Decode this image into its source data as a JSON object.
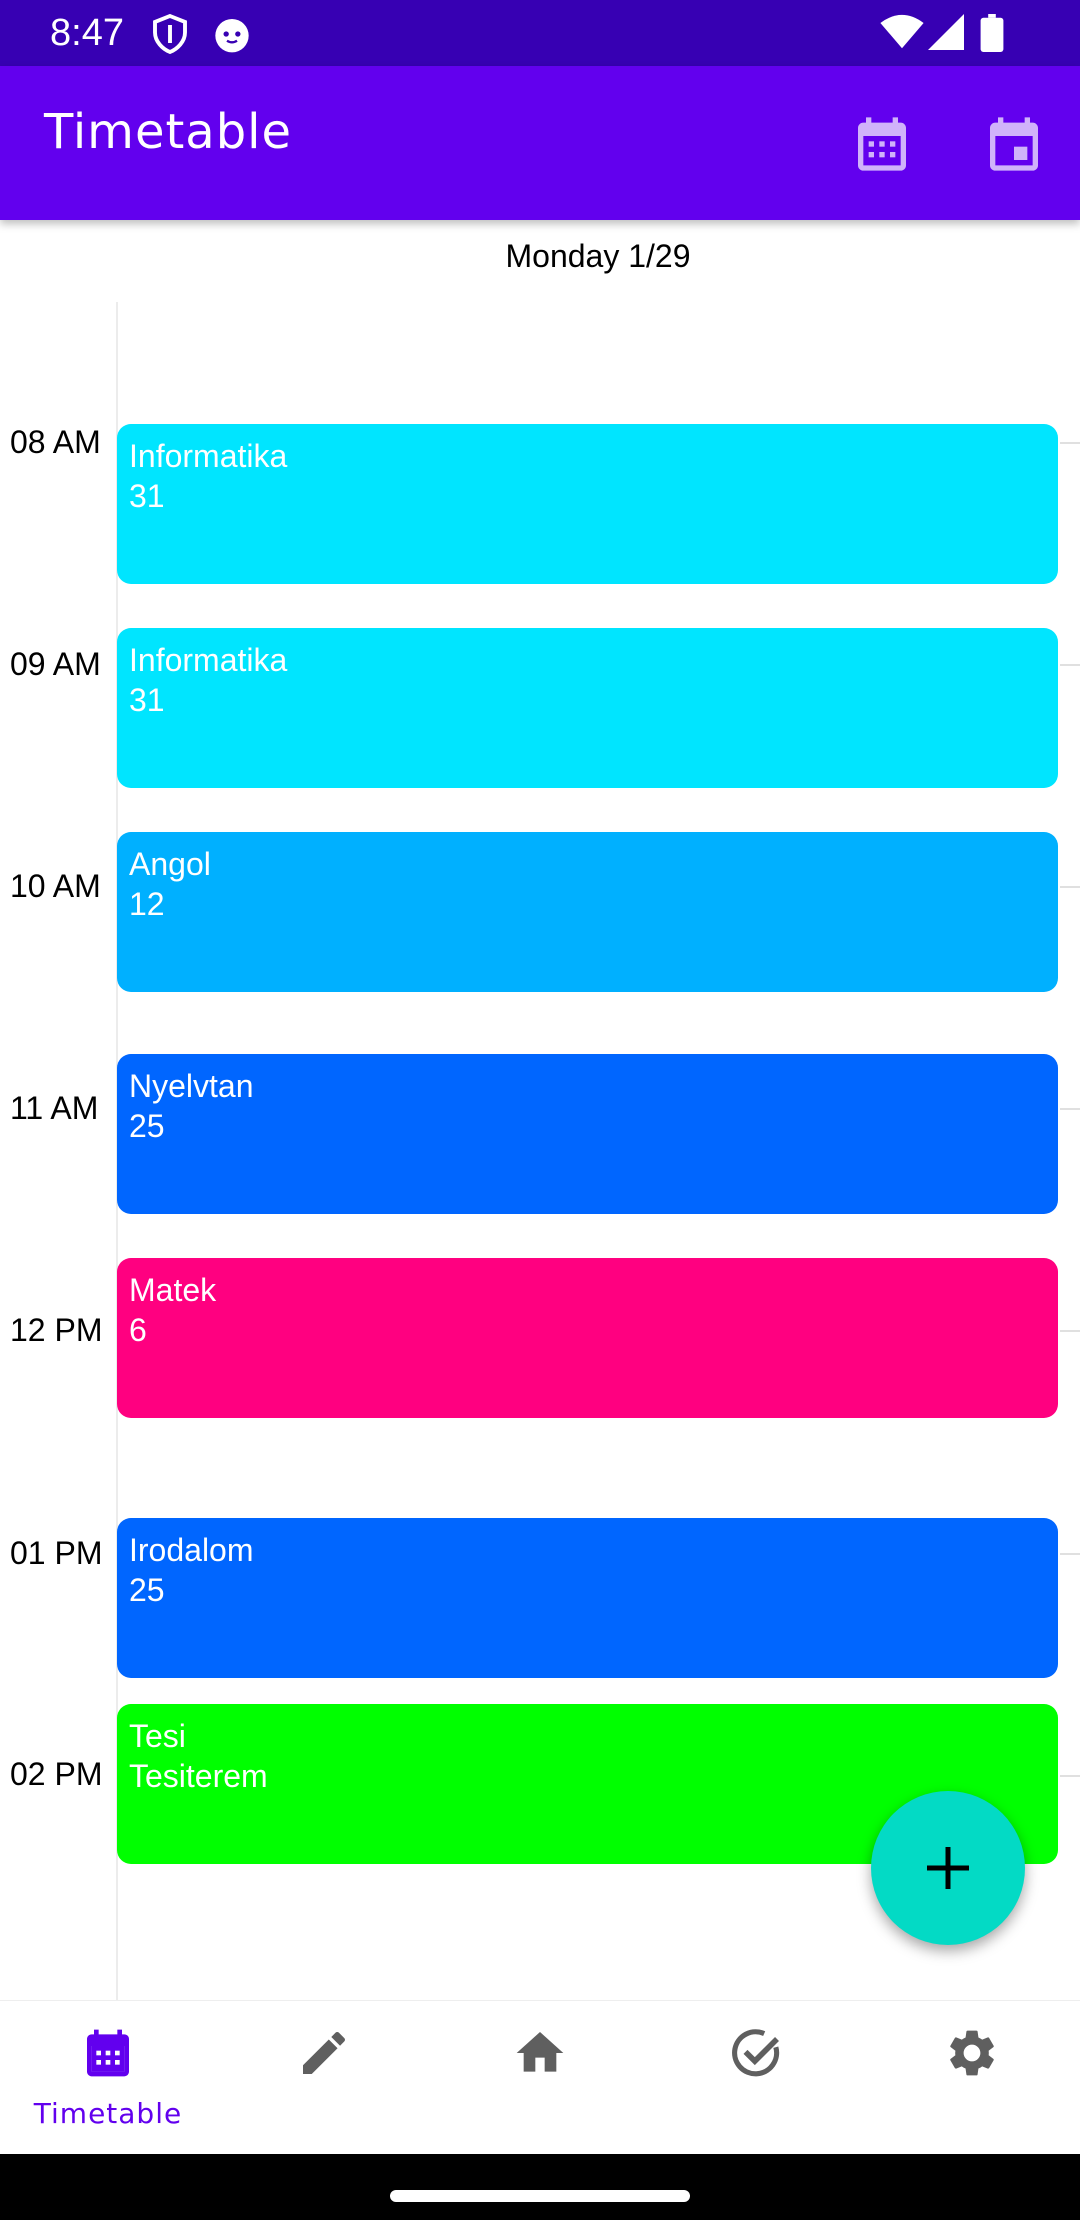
{
  "status_bar": {
    "time": "8:47",
    "icons": [
      "shield-icon",
      "cat-icon",
      "wifi-icon",
      "signal-icon",
      "battery-icon"
    ]
  },
  "app_bar": {
    "title": "Timetable",
    "actions": [
      "calendar-grid-icon",
      "calendar-today-icon"
    ],
    "color": "#6200ee"
  },
  "date_header": "Monday 1/29",
  "time_labels": [
    "08 AM",
    "09 AM",
    "10 AM",
    "11 AM",
    "12 PM",
    "01 PM",
    "02 PM"
  ],
  "events": [
    {
      "subject": "Informatika",
      "room": "31",
      "color": "#00e5ff"
    },
    {
      "subject": "Informatika",
      "room": "31",
      "color": "#00e5ff"
    },
    {
      "subject": "Angol",
      "room": "12",
      "color": "#00b0ff"
    },
    {
      "subject": "Nyelvtan",
      "room": "25",
      "color": "#0066ff"
    },
    {
      "subject": "Matek",
      "room": "6",
      "color": "#ff0080"
    },
    {
      "subject": "Irodalom",
      "room": "25",
      "color": "#0066ff"
    },
    {
      "subject": "Tesi",
      "room": "Tesiterem",
      "color": "#00ff00"
    }
  ],
  "fab": {
    "icon": "plus-icon",
    "color": "#03dac5"
  },
  "bottom_nav": {
    "items": [
      {
        "icon": "calendar-icon",
        "label": "Timetable",
        "active": true
      },
      {
        "icon": "pencil-icon",
        "label": "",
        "active": false
      },
      {
        "icon": "home-icon",
        "label": "",
        "active": false
      },
      {
        "icon": "check-circle-icon",
        "label": "",
        "active": false
      },
      {
        "icon": "gear-icon",
        "label": "",
        "active": false
      }
    ],
    "active_color": "#6200ee",
    "inactive_color": "#5f5f5f"
  }
}
